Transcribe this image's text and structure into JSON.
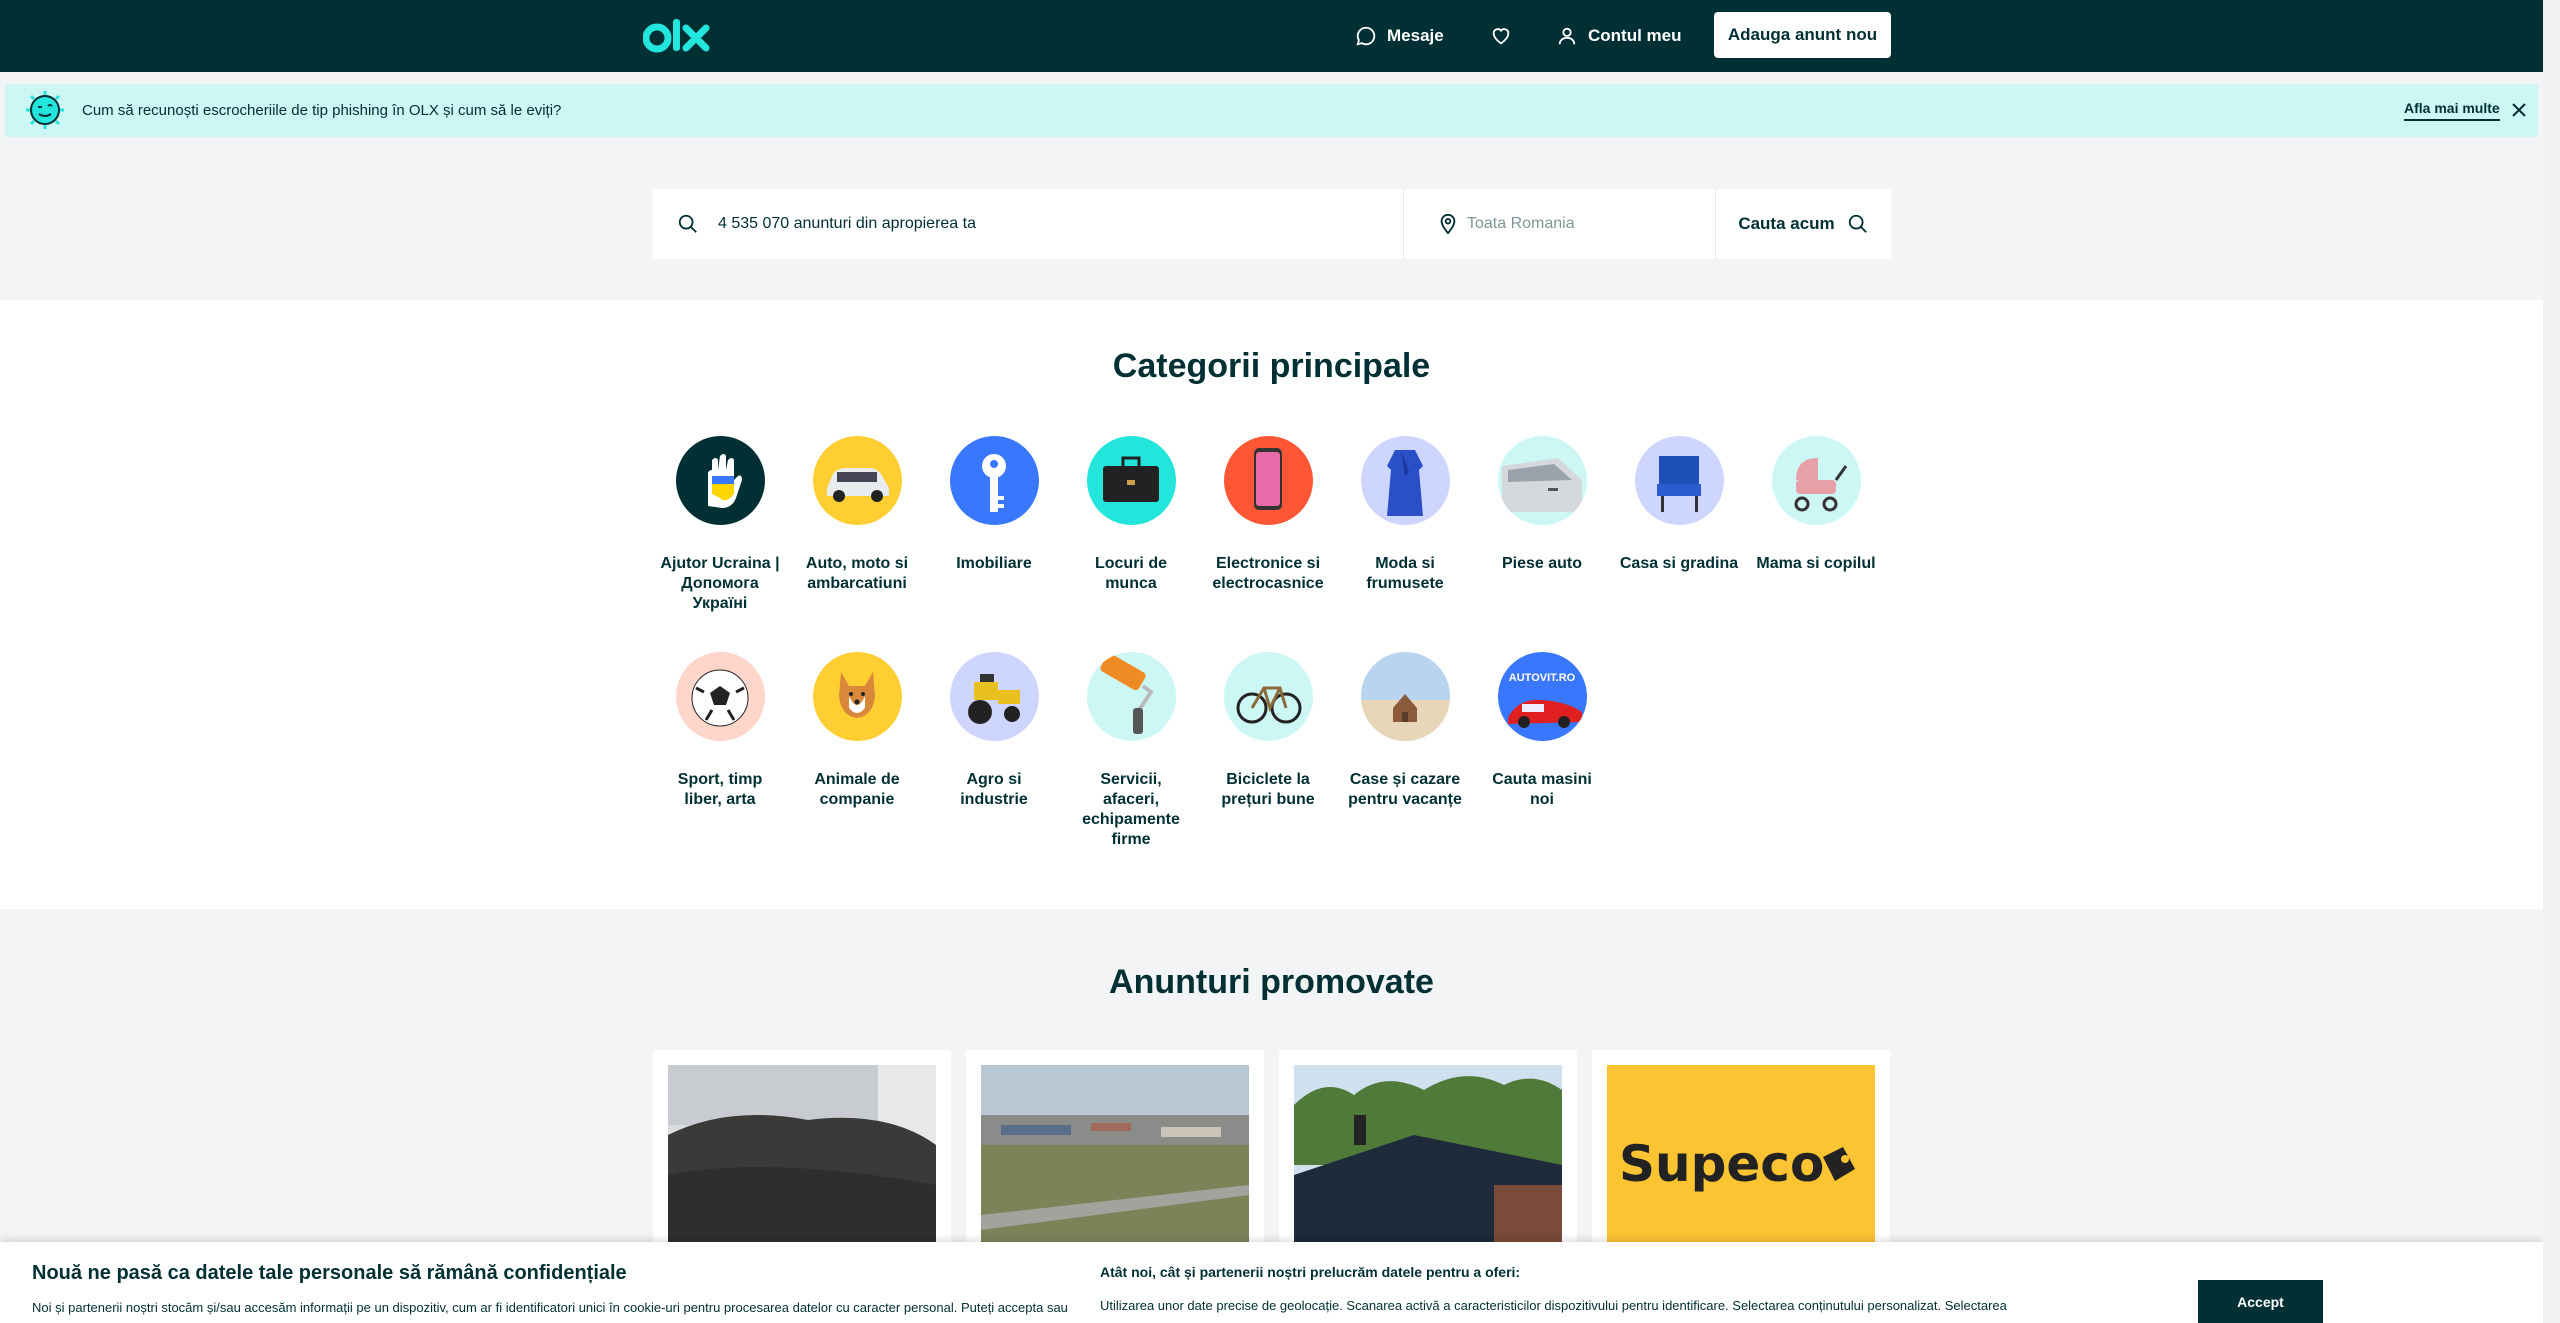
{
  "header": {
    "logo_alt": "olx",
    "messages_label": "Mesaje",
    "account_label": "Contul meu",
    "post_ad_label": "Adauga anunt nou"
  },
  "banner": {
    "text": "Cum să recunoști escrocheriile de tip phishing în OLX și cum să le eviți?",
    "link_label": "Afla mai multe"
  },
  "search": {
    "query_text": "4 535 070 anunturi din apropierea ta",
    "location_placeholder": "Toata Romania",
    "button_label": "Cauta acum"
  },
  "categories": {
    "title": "Categorii principale",
    "items": [
      {
        "label": "Ajutor Ucraina | Допомога Україні",
        "icon": "ukraine-hand-icon",
        "color": "#002f34"
      },
      {
        "label": "Auto, moto si ambarcatiuni",
        "icon": "car-icon",
        "color": "#ffce32"
      },
      {
        "label": "Imobiliare",
        "icon": "key-icon",
        "color": "#3a77ff"
      },
      {
        "label": "Locuri de munca",
        "icon": "briefcase-icon",
        "color": "#23e5db"
      },
      {
        "label": "Electronice si electrocasnice",
        "icon": "phone-icon",
        "color": "#ff5636"
      },
      {
        "label": "Moda si frumusete",
        "icon": "dress-icon",
        "color": "#ced6ff"
      },
      {
        "label": "Piese auto",
        "icon": "car-door-icon",
        "color": "#ccf7f4"
      },
      {
        "label": "Casa si gradina",
        "icon": "chair-icon",
        "color": "#ced6ff"
      },
      {
        "label": "Mama si copilul",
        "icon": "stroller-icon",
        "color": "#ccf7f4"
      },
      {
        "label": "Sport, timp liber, arta",
        "icon": "football-icon",
        "color": "#ffd6c9"
      },
      {
        "label": "Animale de companie",
        "icon": "dog-icon",
        "color": "#ffce32"
      },
      {
        "label": "Agro si industrie",
        "icon": "tractor-icon",
        "color": "#ced6ff"
      },
      {
        "label": "Servicii, afaceri, echipamente firme",
        "icon": "paint-roller-icon",
        "color": "#ccf7f4"
      },
      {
        "label": "Biciclete la prețuri bune",
        "icon": "bicycle-icon",
        "color": "#ccf7f4"
      },
      {
        "label": "Case și cazare pentru vacanțe",
        "icon": "beach-house-icon",
        "color": "#ced6ff"
      },
      {
        "label": "Cauta masini noi",
        "icon": "autovit-icon",
        "color": "#3a77ff",
        "badge_text": "AUTOVIT.RO"
      }
    ]
  },
  "promoted": {
    "title": "Anunturi promovate",
    "cards": [
      {
        "image": "soil-pile-photo"
      },
      {
        "image": "land-plot-aerial-photo"
      },
      {
        "image": "house-roof-photo"
      },
      {
        "image": "supeco-logo",
        "logo_text": "Supeco"
      }
    ]
  },
  "cookie": {
    "title": "Nouă ne pasă ca datele tale personale să rămână confidențiale",
    "text": "Noi și partenerii noștri stocăm și/sau accesăm informații pe un dispozitiv, cum ar fi identificatori unici în cookie-uri pentru procesarea datelor cu caracter personal. Puteți accepta sau",
    "subtitle": "Atât noi, cât și partenerii noștri prelucrăm datele pentru a oferi:",
    "text2": "Utilizarea unor date precise de geolocație. Scanarea activă a caracteristicilor dispozitivului pentru identificare. Selectarea conținutului personalizat. Selectarea",
    "accept_label": "Accept"
  }
}
